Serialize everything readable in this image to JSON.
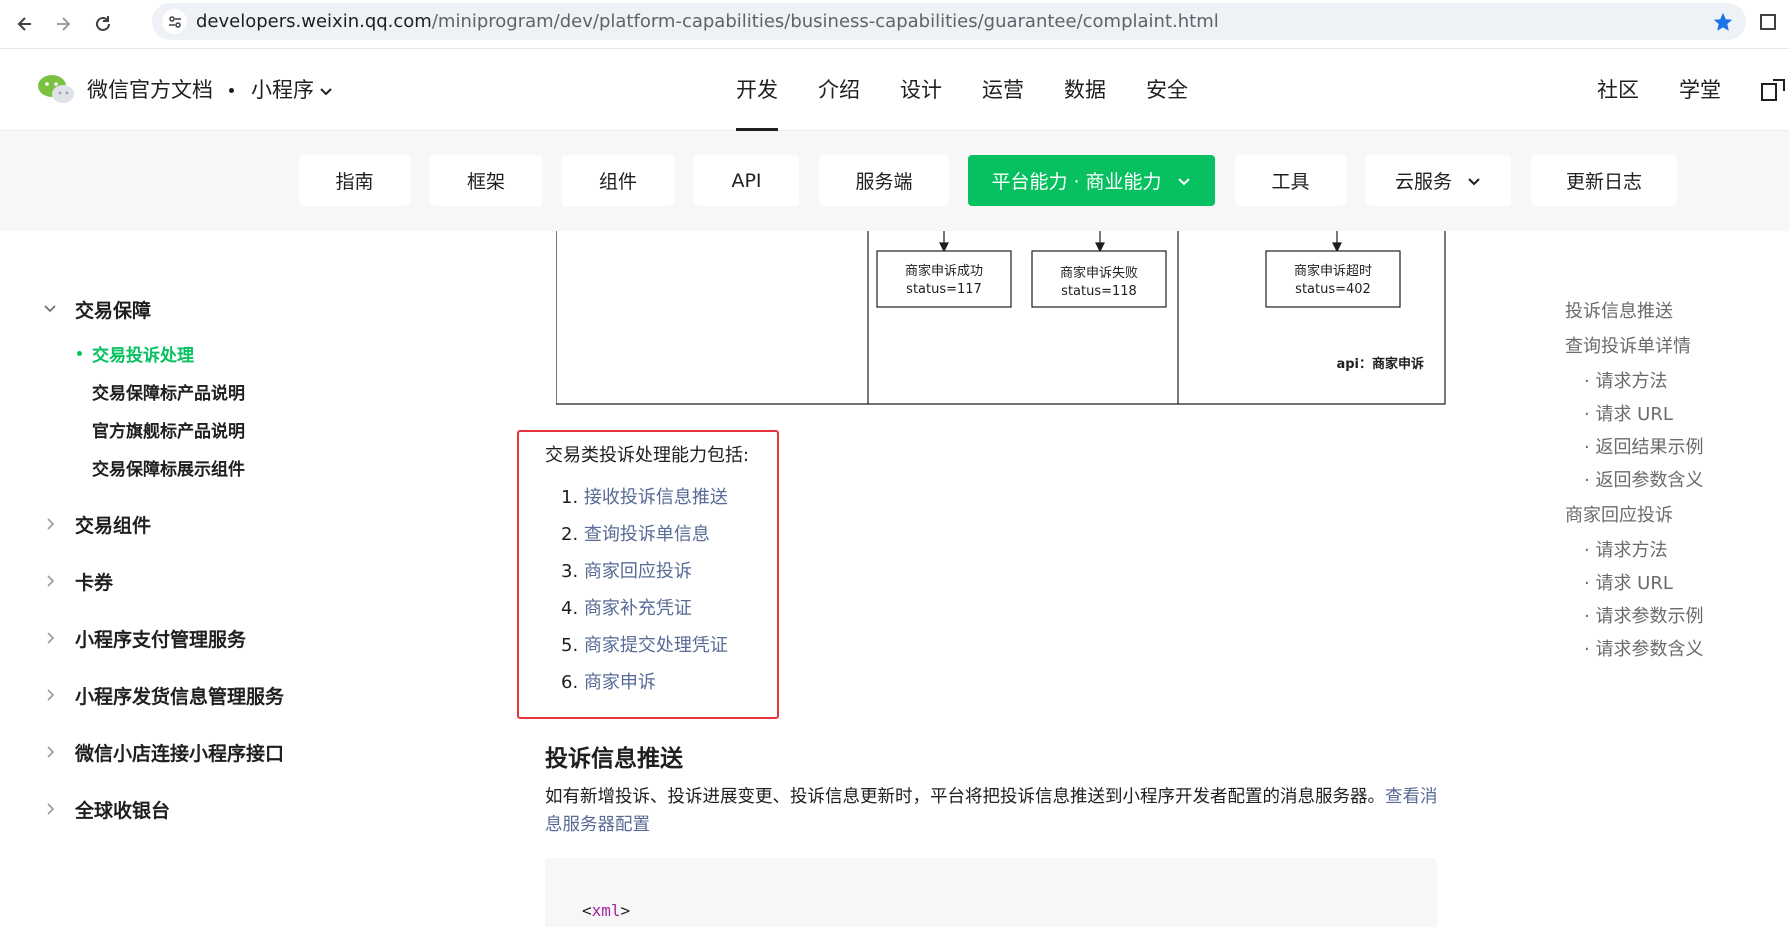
{
  "browser": {
    "url_host": "developers.weixin.qq.com",
    "url_path": "/miniprogram/dev/platform-capabilities/business-capabilities/guarantee/complaint.html",
    "icons": [
      "back-icon",
      "forward-icon",
      "reload-icon",
      "site-settings-icon",
      "bookmark-star-icon",
      "extensions-icon"
    ],
    "accent": "#1a73e8"
  },
  "topnav": {
    "brand": "微信官方文档",
    "product": "小程序",
    "tabs": [
      "开发",
      "介绍",
      "设计",
      "运营",
      "数据",
      "安全"
    ],
    "active_tab": "开发",
    "right_links": [
      "社区",
      "学堂"
    ]
  },
  "subnav": {
    "items": [
      "指南",
      "框架",
      "组件",
      "API",
      "服务端",
      "平台能力 · 商业能力",
      "工具",
      "云服务",
      "更新日志"
    ],
    "active": "平台能力 · 商业能力",
    "active_color": "#07c160"
  },
  "sidebar": {
    "expanded_group": "交易保障",
    "sub_items": [
      "交易投诉处理",
      "交易保障标产品说明",
      "官方旗舰标产品说明",
      "交易保障标展示组件"
    ],
    "active_sub_item": "交易投诉处理",
    "groups": [
      "交易组件",
      "卡券",
      "小程序支付管理服务",
      "小程序发货信息管理服务",
      "微信小店连接小程序接口",
      "全球收银台"
    ]
  },
  "diagram": {
    "boxes": [
      {
        "line1": "商家申诉成功",
        "line2": "status=117"
      },
      {
        "line1": "商家申诉失败",
        "line2": "status=118"
      },
      {
        "line1": "商家申诉超时",
        "line2": "status=402"
      }
    ],
    "api_label": "api：商家申诉"
  },
  "content": {
    "intro": "交易类投诉处理能力包括:",
    "capabilities": [
      {
        "num": "1.",
        "label": "接收投诉信息推送"
      },
      {
        "num": "2.",
        "label": "查询投诉单信息"
      },
      {
        "num": "3.",
        "label": "商家回应投诉"
      },
      {
        "num": "4.",
        "label": "商家补充凭证"
      },
      {
        "num": "5.",
        "label": "商家提交处理凭证"
      },
      {
        "num": "6.",
        "label": "商家申诉"
      }
    ],
    "section_title": "投诉信息推送",
    "section_desc": "如有新增投诉、投诉进展变更、投诉信息更新时，平台将把投诉信息推送到小程序开发者配置的消息服务器。",
    "section_link": "查看消息服务器配置",
    "code_open": "<",
    "code_tag": "xml",
    "code_close": ">",
    "link_color": "#576b95",
    "highlight_color": "#e8343c"
  },
  "toc": {
    "items": [
      {
        "label": "投诉信息推送",
        "level": 1
      },
      {
        "label": "查询投诉单详情",
        "level": 1
      },
      {
        "label": "· 请求方法",
        "level": 2
      },
      {
        "label": "· 请求 URL",
        "level": 2
      },
      {
        "label": "· 返回结果示例",
        "level": 2
      },
      {
        "label": "· 返回参数含义",
        "level": 2
      },
      {
        "label": "商家回应投诉",
        "level": 1
      },
      {
        "label": "· 请求方法",
        "level": 2
      },
      {
        "label": "· 请求 URL",
        "level": 2
      },
      {
        "label": "· 请求参数示例",
        "level": 2
      },
      {
        "label": "· 请求参数含义",
        "level": 2
      }
    ]
  }
}
